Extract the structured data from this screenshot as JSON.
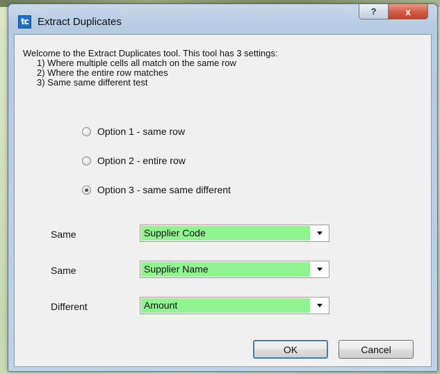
{
  "window": {
    "title": "Extract Duplicates",
    "help_label": "?",
    "close_label": "x"
  },
  "intro": {
    "line1": "Welcome to the Extract Duplicates tool. This tool has 3 settings:",
    "line2": "1) Where multiple cells all match on the same row",
    "line3": "2) Where the entire row matches",
    "line4": "3) Same same different test"
  },
  "options": [
    {
      "label": "Option 1 - same row",
      "checked": false
    },
    {
      "label": "Option 2 - entire row",
      "checked": false
    },
    {
      "label": "Option 3 - same same different",
      "checked": true
    }
  ],
  "fields": [
    {
      "label": "Same",
      "value": "Supplier Code"
    },
    {
      "label": "Same",
      "value": "Supplier Name"
    },
    {
      "label": "Different",
      "value": "Amount"
    }
  ],
  "buttons": {
    "ok": "OK",
    "cancel": "Cancel"
  },
  "colors": {
    "combo_highlight": "#90f590",
    "close_button": "#c1432b"
  }
}
